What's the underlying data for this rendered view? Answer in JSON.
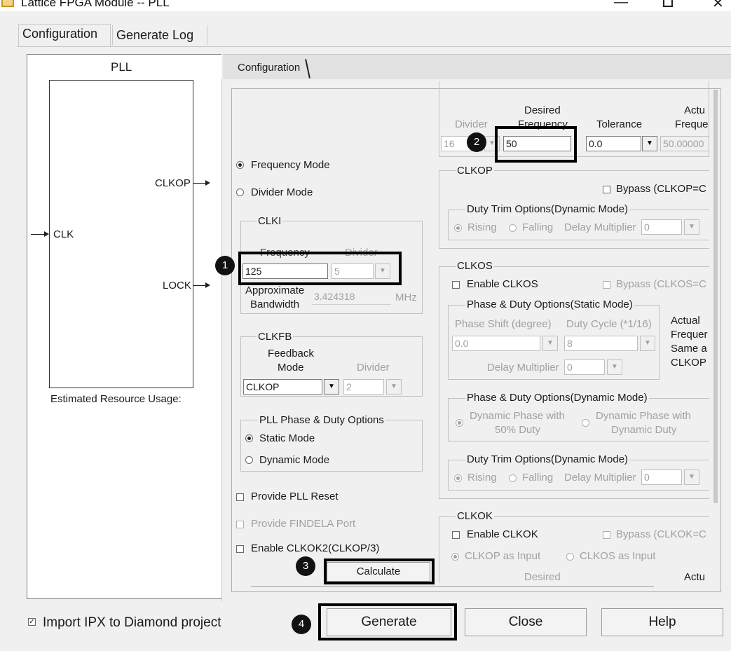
{
  "window": {
    "title": "Lattice FPGA Module -- PLL",
    "minimize_icon": "minimize-icon",
    "maximize_icon": "maximize-icon",
    "close_icon": "close-icon"
  },
  "tabs": [
    {
      "label": "Configuration"
    },
    {
      "label": "Generate Log"
    }
  ],
  "diagram": {
    "title": "PLL",
    "ports": {
      "clkop": "CLKOP",
      "lock": "LOCK",
      "clk": "CLK"
    },
    "resource_label": "Estimated Resource Usage:"
  },
  "inner_tab": {
    "label": "Configuration"
  },
  "mode": {
    "frequency": "Frequency Mode",
    "divider": "Divider Mode",
    "selected": "frequency"
  },
  "clki": {
    "group": "CLKI",
    "frequency_label": "Frequency",
    "divider_label": "Divider",
    "frequency_value": "125",
    "divider_value": "5",
    "bandwidth_label_1": "Approximate",
    "bandwidth_label_2": "Bandwidth",
    "bandwidth_value": "3.424318",
    "bandwidth_unit": "MHz"
  },
  "clkfb": {
    "group": "CLKFB",
    "mode_label_1": "Feedback",
    "mode_label_2": "Mode",
    "divider_label": "Divider",
    "mode_value": "CLKOP",
    "divider_value": "2"
  },
  "phase_duty": {
    "group": "PLL Phase & Duty Options",
    "static": "Static Mode",
    "dynamic": "Dynamic Mode"
  },
  "options": {
    "pll_reset": "Provide PLL Reset",
    "findela": "Provide FINDELA Port",
    "clkok2": "Enable CLKOK2(CLKOP/3)"
  },
  "calculate_button": "Calculate",
  "top_output": {
    "divider_label": "Divider",
    "desired_label_1": "Desired",
    "desired_label_2": "Frequency",
    "tolerance_label": "Tolerance",
    "actual_label_1": "Actu",
    "actual_label_2": "Freque",
    "divider_value": "16",
    "desired_value": "50",
    "tolerance_value": "0.0",
    "actual_value": "50.00000"
  },
  "clkop": {
    "group": "CLKOP",
    "bypass": "Bypass (CLKOP=C",
    "duty_trim_group": "Duty Trim Options(Dynamic Mode)",
    "rising": "Rising",
    "falling": "Falling",
    "delay_multiplier": "Delay Multiplier",
    "delay_value": "0"
  },
  "clkos": {
    "group": "CLKOS",
    "enable": "Enable CLKOS",
    "bypass": "Bypass (CLKOS=C",
    "static_group": "Phase & Duty Options(Static Mode)",
    "phase_shift_label": "Phase Shift (degree)",
    "duty_cycle_label": "Duty Cycle (*1/16)",
    "phase_value": "0.0",
    "duty_value": "8",
    "delay_multiplier": "Delay Multiplier",
    "delay_value": "0",
    "actual_lines": [
      "Actual",
      "Frequer",
      "Same a",
      "CLKOP"
    ],
    "dynamic_group": "Phase & Duty Options(Dynamic Mode)",
    "dyn_phase_50_1": "Dynamic Phase with",
    "dyn_phase_50_2": "50% Duty",
    "dyn_phase_dd_1": "Dynamic Phase with",
    "dyn_phase_dd_2": "Dynamic Duty",
    "duty_trim_group": "Duty Trim Options(Dynamic Mode)",
    "rising": "Rising",
    "falling": "Falling",
    "trim_delay_multiplier": "Delay Multiplier",
    "trim_delay_value": "0"
  },
  "clkok": {
    "group": "CLKOK",
    "enable": "Enable CLKOK",
    "bypass": "Bypass (CLKOK=C",
    "clkop_input": "CLKOP as Input",
    "clkos_input": "CLKOS as Input",
    "desired_label": "Desired",
    "actual_label": "Actu"
  },
  "footer": {
    "import_ipx": "Import IPX to Diamond project",
    "generate": "Generate",
    "close": "Close",
    "help": "Help"
  },
  "badges": [
    "1",
    "2",
    "3",
    "4"
  ],
  "colors": {
    "highlight": "#000000",
    "disabled_text": "#a0a0a0",
    "panel_bg": "#f0f0f0"
  }
}
